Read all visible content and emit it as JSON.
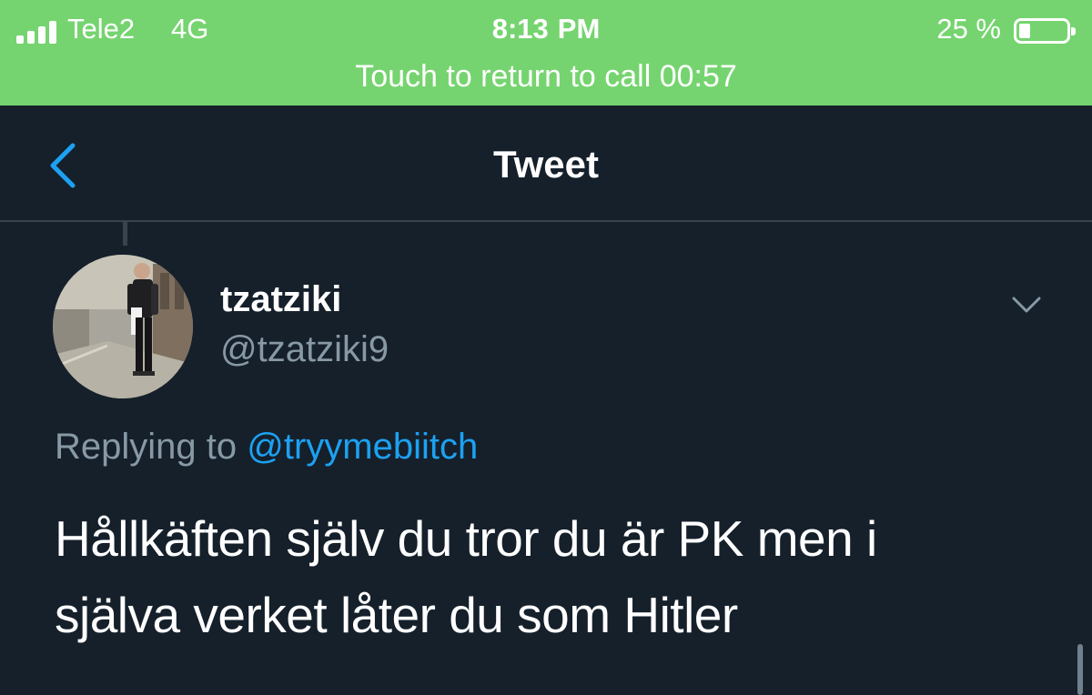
{
  "status_bar": {
    "carrier": "Tele2",
    "network": "4G",
    "time": "8:13",
    "ampm": "PM",
    "battery_percent": "25 %",
    "battery_level": 0.25,
    "signal_bars": 4,
    "call_banner": "Touch to return to call 00:57",
    "bar_color": "#75d46f"
  },
  "navbar": {
    "title": "Tweet",
    "back_icon": "chevron-left-icon"
  },
  "tweet": {
    "display_name": "tzatziki",
    "handle": "@tzatziki9",
    "replying_prefix": "Replying to",
    "replying_to": "@tryymebiitch",
    "text_line_1": "Hållkäften själv du tror du är PK men i",
    "text_line_2": "själva verket låter du som Hitler",
    "more_icon": "chevron-down-icon"
  },
  "colors": {
    "background": "#15202b",
    "divider": "#38444d",
    "secondary_text": "#8899a6",
    "accent": "#1da1f2"
  }
}
